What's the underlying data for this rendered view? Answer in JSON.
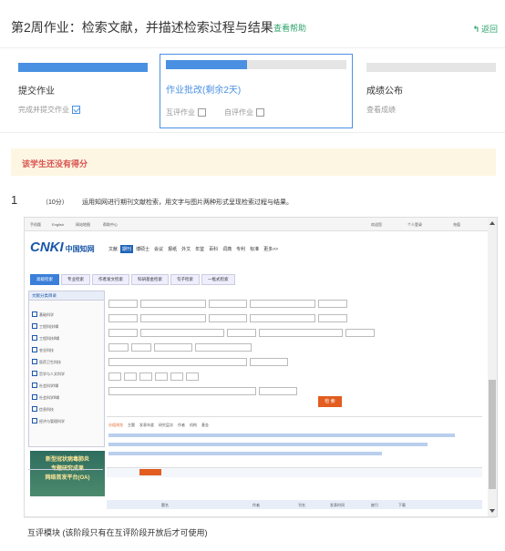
{
  "header": {
    "title": "第2周作业：检索文献，并描述检索过程与结果",
    "help_link": "查看帮助",
    "back_link": "返回"
  },
  "progress_cards": [
    {
      "name": "提交作业",
      "subtask_1": "完成并提交作业",
      "subtask_1_done": true,
      "progress": 1.0
    },
    {
      "name": "作业批改(剩余2天)",
      "subtask_1": "互评作业",
      "subtask_1_done": false,
      "subtask_2": "自评作业",
      "subtask_2_done": false,
      "progress": 0.45
    },
    {
      "name": "成绩公布",
      "subtask_1": "查看成绩",
      "progress": 0.0
    }
  ],
  "alert": {
    "text": "该学生还没有得分"
  },
  "question": {
    "number": "1",
    "score": "（10分）",
    "text": "运用知网进行期刊文献检索，用文字与图片两种形式呈现检索过程与结果。"
  },
  "embedded_screenshot": {
    "topbar_items": [
      "手机版",
      "English",
      "网站地图",
      "帮助中心",
      "欢迎您",
      "个人登录",
      "充值"
    ],
    "logo_text": "CNKI",
    "logo_cn": "中国知网",
    "nav_tabs": [
      "文献",
      "期刊",
      "博硕士",
      "会议",
      "报纸",
      "外文",
      "年鉴",
      "百科",
      "词典",
      "专利",
      "标准",
      "更多>>"
    ],
    "active_nav_tab": "期刊",
    "sub_tabs": [
      "高级检索",
      "专业检索",
      "作者发文检索",
      "科研基金检索",
      "句子检索",
      "一框式检索"
    ],
    "sidebar_title": "文献分类目录",
    "sidebar_items": [
      "基础科学",
      "工程科技Ⅰ辑",
      "工程科技Ⅱ辑",
      "农业科技",
      "医药卫生科技",
      "哲学与人文科学",
      "社会科学Ⅰ辑",
      "社会科学Ⅱ辑",
      "信息科技",
      "经济与管理科学"
    ],
    "search_button": "检 索",
    "banner_text_1": "新型冠状病毒肺炎",
    "banner_text_2": "专题研究成果",
    "banner_text_3": "网络首发平台(OA)",
    "results_tabs": [
      "分组浏览",
      "主题",
      "发表年度",
      "研究层次",
      "作者",
      "机构",
      "基金"
    ],
    "table_headers": [
      "题名",
      "作者",
      "刊名",
      "发表时间",
      "被引",
      "下载"
    ]
  },
  "peer_section": {
    "text": "互评模块 (该阶段只有在互评阶段开放后才可使用)"
  }
}
